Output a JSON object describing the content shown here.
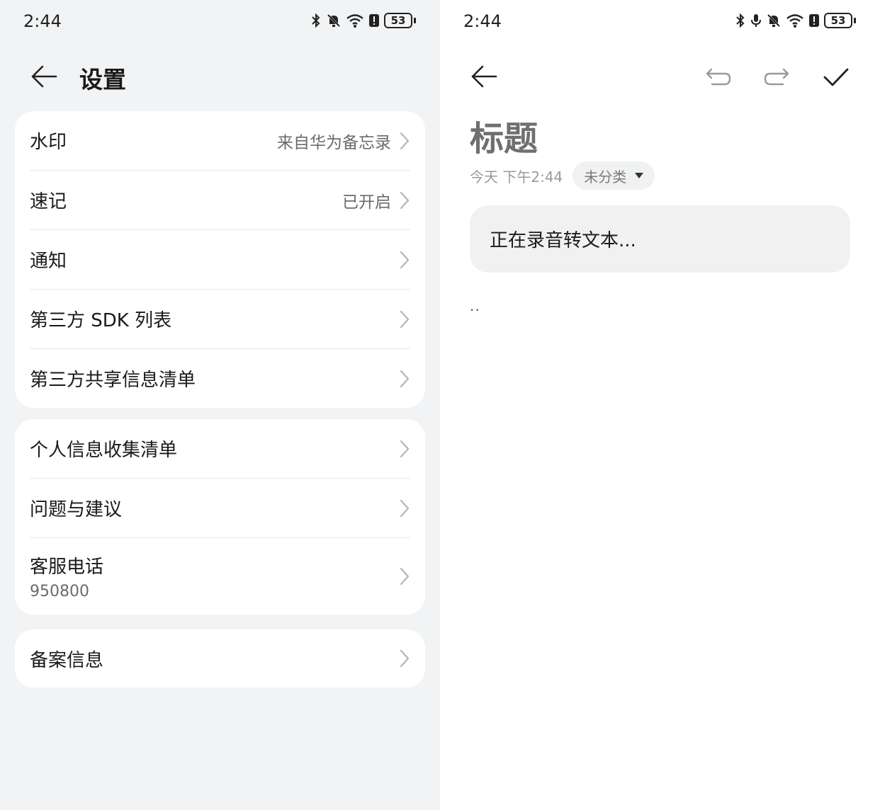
{
  "left": {
    "status": {
      "time": "2:44",
      "battery": "53"
    },
    "title": "设置",
    "cards": [
      [
        {
          "label": "水印",
          "value": "来自华为备忘录"
        },
        {
          "label": "速记",
          "value": "已开启"
        },
        {
          "label": "通知",
          "value": ""
        },
        {
          "label": "第三方 SDK 列表",
          "value": ""
        },
        {
          "label": "第三方共享信息清单",
          "value": ""
        }
      ],
      [
        {
          "label": "个人信息收集清单",
          "value": ""
        },
        {
          "label": "问题与建议",
          "value": ""
        },
        {
          "label": "客服电话",
          "sub": "950800"
        }
      ],
      [
        {
          "label": "备案信息",
          "value": ""
        }
      ]
    ]
  },
  "right": {
    "status": {
      "time": "2:44",
      "battery": "53"
    },
    "note_title": "标题",
    "date": "今天 下午2:44",
    "category": "未分类",
    "recording_text": "正在录音转文本...",
    "body_text": ".."
  }
}
